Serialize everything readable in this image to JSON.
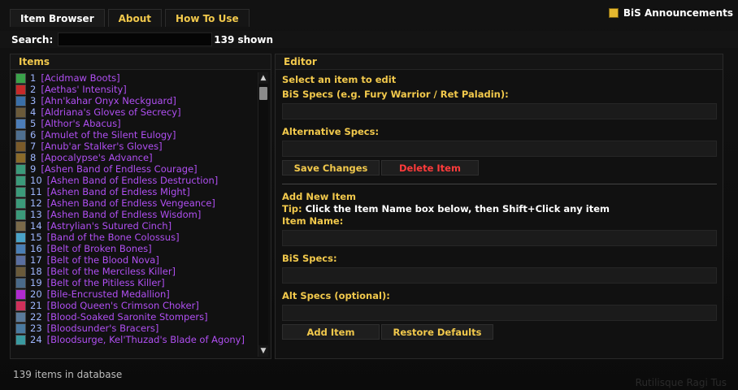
{
  "tabs": [
    {
      "label": "Item Browser",
      "active": true
    },
    {
      "label": "About",
      "active": false
    },
    {
      "label": "How To Use",
      "active": false
    }
  ],
  "bis_announcements": {
    "label": "BiS Announcements",
    "checked": true,
    "color": "#e5b82f"
  },
  "search": {
    "label": "Search:",
    "value": "",
    "shown_text": "139 shown"
  },
  "items_panel": {
    "title": "Items",
    "items": [
      {
        "num": "1",
        "name": "[Acidmaw Boots]",
        "icon_color": "#3aa24a"
      },
      {
        "num": "2",
        "name": "[Aethas' Intensity]",
        "icon_color": "#c62a2a"
      },
      {
        "num": "3",
        "name": "[Ahn'kahar Onyx Neckguard]",
        "icon_color": "#3a6fa8"
      },
      {
        "num": "4",
        "name": "[Aldriana's Gloves of Secrecy]",
        "icon_color": "#6b5a3a"
      },
      {
        "num": "5",
        "name": "[Althor's Abacus]",
        "icon_color": "#4c7db8"
      },
      {
        "num": "6",
        "name": "[Amulet of the Silent Eulogy]",
        "icon_color": "#4f6f8f"
      },
      {
        "num": "7",
        "name": "[Anub'ar Stalker's Gloves]",
        "icon_color": "#7a5a2a"
      },
      {
        "num": "8",
        "name": "[Apocalypse's Advance]",
        "icon_color": "#8a6a2a"
      },
      {
        "num": "9",
        "name": "[Ashen Band of Endless Courage]",
        "icon_color": "#3b9a7a"
      },
      {
        "num": "10",
        "name": "[Ashen Band of Endless Destruction]",
        "icon_color": "#3b9a7a"
      },
      {
        "num": "11",
        "name": "[Ashen Band of Endless Might]",
        "icon_color": "#3b9a7a"
      },
      {
        "num": "12",
        "name": "[Ashen Band of Endless Vengeance]",
        "icon_color": "#3b9a7a"
      },
      {
        "num": "13",
        "name": "[Ashen Band of Endless Wisdom]",
        "icon_color": "#3b9a7a"
      },
      {
        "num": "14",
        "name": "[Astrylian's Sutured Cinch]",
        "icon_color": "#7a6a4a"
      },
      {
        "num": "15",
        "name": "[Band of the Bone Colossus]",
        "icon_color": "#4aa3c8"
      },
      {
        "num": "16",
        "name": "[Belt of Broken Bones]",
        "icon_color": "#4a7fb5"
      },
      {
        "num": "17",
        "name": "[Belt of the Blood Nova]",
        "icon_color": "#5a6fa0"
      },
      {
        "num": "18",
        "name": "[Belt of the Merciless Killer]",
        "icon_color": "#6a5a3a"
      },
      {
        "num": "19",
        "name": "[Belt of the Pitiless Killer]",
        "icon_color": "#4a6a8a"
      },
      {
        "num": "20",
        "name": "[Bile-Encrusted Medallion]",
        "icon_color": "#b02ad0"
      },
      {
        "num": "21",
        "name": "[Blood Queen's Crimson Choker]",
        "icon_color": "#d0305a"
      },
      {
        "num": "22",
        "name": "[Blood-Soaked Saronite Stompers]",
        "icon_color": "#5a7a9a"
      },
      {
        "num": "23",
        "name": "[Bloodsunder's Bracers]",
        "icon_color": "#4a7aa0"
      },
      {
        "num": "24",
        "name": "[Bloodsurge, Kel'Thuzad's Blade of Agony]",
        "icon_color": "#3a9aa0"
      }
    ]
  },
  "editor": {
    "title": "Editor",
    "select_prompt": "Select an item to edit",
    "bis_specs_label": "BiS Specs (e.g. Fury Warrior / Ret Paladin):",
    "alt_specs_label": "Alternative Specs:",
    "save_label": "Save Changes",
    "delete_label": "Delete Item",
    "add_new_title": "Add New Item",
    "tip_prefix": "Tip:",
    "tip_text": "Click the Item Name box below, then Shift+Click any item",
    "item_name_label": "Item Name:",
    "new_bis_label": "BiS Specs:",
    "new_alt_label": "Alt Specs (optional):",
    "add_label": "Add Item",
    "restore_label": "Restore Defaults"
  },
  "footer": {
    "status": "139 items in database"
  },
  "watermark": "Rutilisque Ragi Tus"
}
